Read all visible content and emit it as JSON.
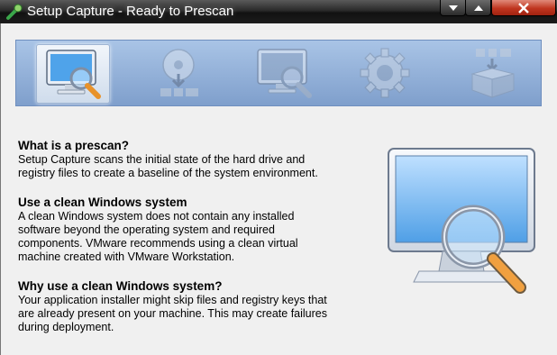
{
  "window": {
    "title": "Setup Capture - Ready to Prescan",
    "buttons": [
      "minimize",
      "maximize",
      "close"
    ]
  },
  "steps": [
    {
      "name": "prescan",
      "icon": "monitor-magnifier-icon",
      "active": true
    },
    {
      "name": "install",
      "icon": "disc-install-icon",
      "active": false
    },
    {
      "name": "postscan",
      "icon": "monitor-magnifier-icon",
      "active": false
    },
    {
      "name": "configure",
      "icon": "gear-icon",
      "active": false
    },
    {
      "name": "build",
      "icon": "package-icon",
      "active": false
    }
  ],
  "sections": [
    {
      "heading": "What is a prescan?",
      "lines": [
        "Setup Capture scans the initial state of the hard drive and",
        "registry files to create a baseline of the system environment."
      ]
    },
    {
      "heading": "Use a clean Windows system",
      "lines": [
        "A clean Windows system does not contain any installed",
        "software beyond the operating system and required",
        "components. VMware recommends using a clean virtual",
        "machine created with VMware Workstation."
      ]
    },
    {
      "heading": "Why use a clean Windows system?",
      "lines": [
        "Your application installer might skip files and registry keys that",
        "are already present on your machine. This may create failures",
        "during deployment."
      ]
    }
  ],
  "colors": {
    "banner": "#8faad6",
    "screen": "#6cb3f0",
    "close_button": "#c0351f"
  }
}
